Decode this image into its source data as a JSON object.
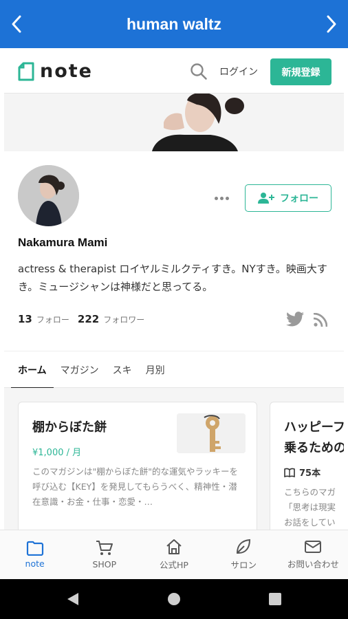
{
  "app_bar": {
    "title": "human waltz"
  },
  "header": {
    "logo_text": "note",
    "login_label": "ログイン",
    "signup_label": "新規登録"
  },
  "profile": {
    "name": "Nakamura Mami",
    "bio": "actress & therapist ロイヤルミルクティすき。NYすき。映画大すき。ミュージシャンは神様だと思ってる。",
    "follow_label": "フォロー",
    "following_count": "13",
    "following_label": "フォロー",
    "followers_count": "222",
    "followers_label": "フォロワー"
  },
  "tabs": [
    {
      "label": "ホーム",
      "active": true
    },
    {
      "label": "マガジン",
      "active": false
    },
    {
      "label": "スキ",
      "active": false
    },
    {
      "label": "月別",
      "active": false
    }
  ],
  "cards": [
    {
      "title": "棚からぼた餅",
      "price": "¥1,000 / 月",
      "description": "このマガジンは\"棚からぼた餅\"的な運気やラッキーを呼び込む【KEY】を発見してもらうべく、精神性・潜在意識・お金・仕事・恋愛・…"
    },
    {
      "title_line1": "ハッピーフ",
      "title_line2": "乗るための",
      "count": "75本",
      "desc_line1": "こちらのマガ",
      "desc_line2": "「思考は現実",
      "desc_line3": "お話をしてい"
    }
  ],
  "bottom_nav": [
    {
      "label": "note",
      "icon": "note-icon",
      "active": true
    },
    {
      "label": "SHOP",
      "icon": "cart-icon",
      "active": false
    },
    {
      "label": "公式HP",
      "icon": "home-icon",
      "active": false
    },
    {
      "label": "サロン",
      "icon": "leaf-icon",
      "active": false
    },
    {
      "label": "お問い合わせ",
      "icon": "mail-icon",
      "active": false
    }
  ],
  "colors": {
    "app_bar": "#1d72d6",
    "accent": "#2cb696",
    "active_nav": "#1d72d6"
  }
}
